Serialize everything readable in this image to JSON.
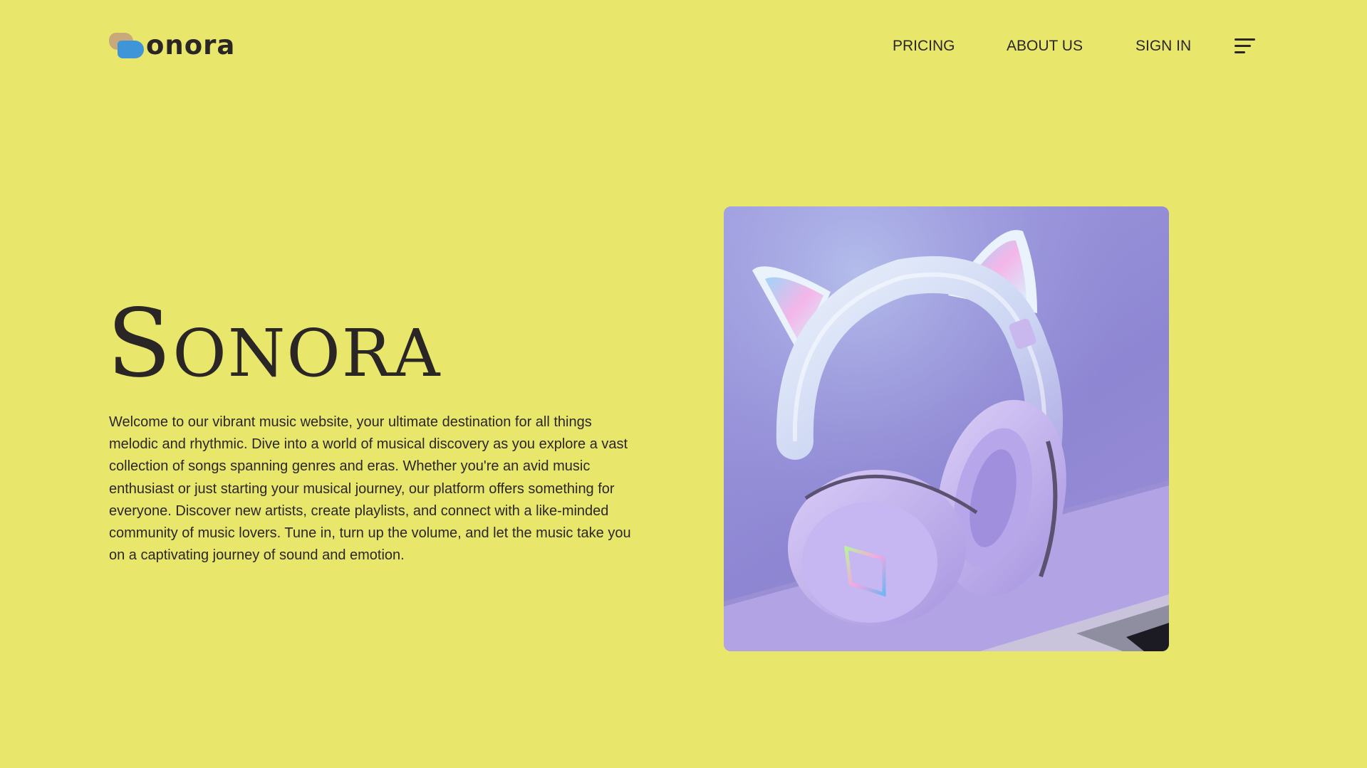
{
  "header": {
    "logo_text": "onora",
    "nav": [
      {
        "label": "PRICING"
      },
      {
        "label": "ABOUT US"
      },
      {
        "label": "SIGN IN"
      }
    ],
    "menu_icon": "hamburger-menu-icon"
  },
  "hero": {
    "title": "Sonora",
    "description": "Welcome to our vibrant music website, your ultimate destination for all things melodic and rhythmic. Dive into a world of musical discovery as you explore a vast collection of songs spanning genres and eras. Whether you're an avid music enthusiast or just starting your musical journey, our platform offers something for everyone. Discover new artists, create playlists, and connect with a like-minded community of music lovers. Tune in, turn up the volume, and let the music take you on a captivating journey of sound and emotion.",
    "image_subject": "lavender cat-ear headphones"
  },
  "colors": {
    "background": "#e9e76b",
    "text": "#2b2626",
    "logo_blue": "#3e95d8",
    "logo_tan": "#c9a97a",
    "image_background": "#8e86d2"
  }
}
